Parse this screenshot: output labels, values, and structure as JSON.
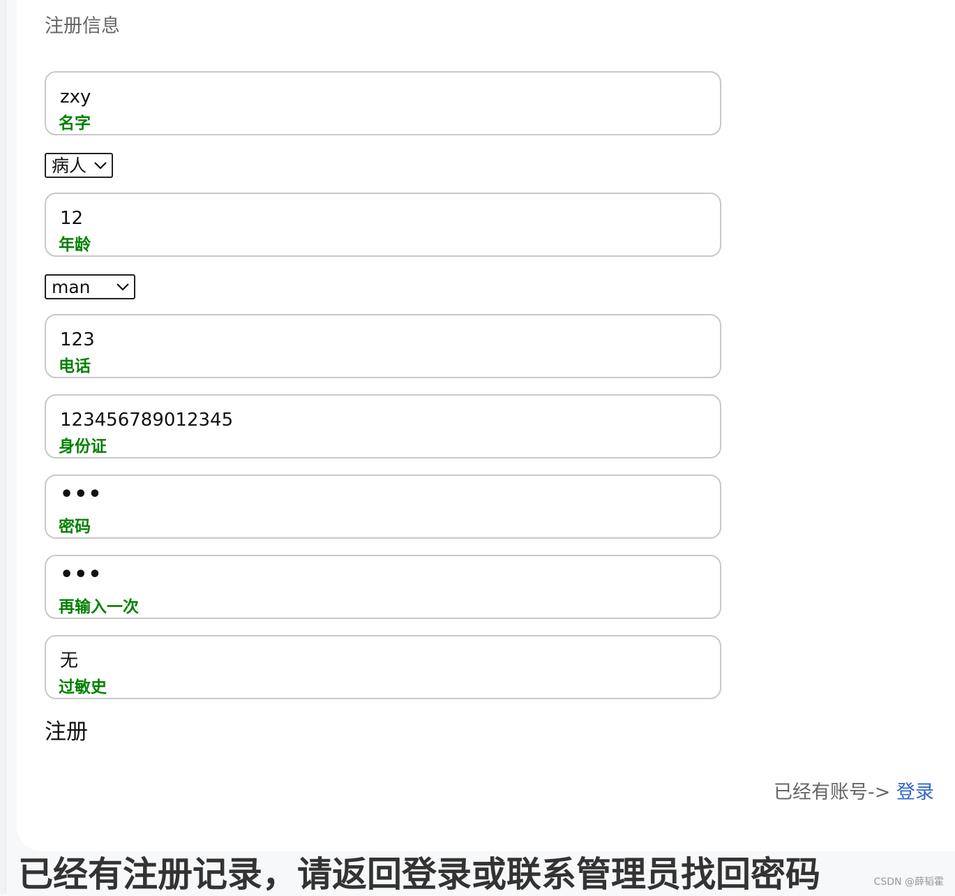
{
  "form": {
    "title": "注册信息",
    "name": {
      "value": "zxy",
      "label": "名字"
    },
    "role_select": {
      "selected": "病人"
    },
    "age": {
      "value": "12",
      "label": "年龄"
    },
    "gender_select": {
      "selected": "man"
    },
    "phone": {
      "value": "123",
      "label": "电话"
    },
    "id_card": {
      "value": "123456789012345",
      "label": "身份证"
    },
    "password": {
      "value": "•••",
      "label": "密码"
    },
    "password_confirm": {
      "value": "•••",
      "label": "再输入一次"
    },
    "allergy": {
      "value": "无",
      "label": "过敏史"
    },
    "register_label": "注册",
    "have_account_text": "已经有账号->",
    "login_label": "登录"
  },
  "banner": {
    "text": "已经有注册记录，请返回登录或联系管理员找回密码"
  },
  "watermark": "CSDN @薛韬霍",
  "colors": {
    "label_green": "#008000",
    "link_blue": "#3366cc",
    "field_border": "#c8c8c8",
    "muted_text": "#666666"
  }
}
